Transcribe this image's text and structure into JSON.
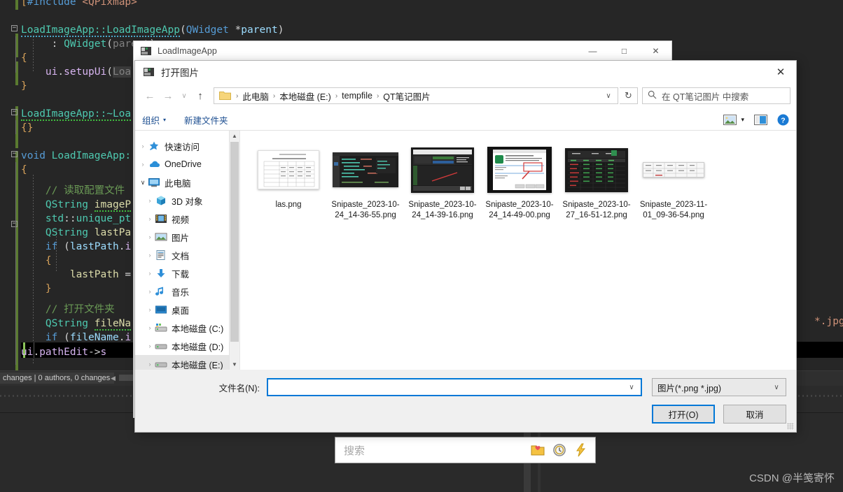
{
  "ide": {
    "code_lines": [
      "#include <QPixmap>",
      "",
      "LoadImageApp::LoadImageApp(QWidget *parent)",
      "    : QWidget(parent)",
      "{",
      "    ui.setupUi(Loa",
      "}",
      "",
      "LoadImageApp::~Loa",
      "{}",
      "",
      "void LoadImageApp:",
      "{",
      "    // 读取配置文件",
      "    QString imageP",
      "    std::unique_pt",
      "    QString lastPa",
      "    if (lastPath.i",
      "    {",
      "        lastPath =",
      "    }",
      "",
      "    // 打开文件夹",
      "    QString fileNa",
      "    if (fileName.i",
      "    ui.pathEdit->s"
    ],
    "right_fragment": "*.jpg);",
    "status_text": "changes | 0 authors, 0 changes"
  },
  "qt_search": {
    "placeholder": "搜索",
    "icons": [
      "folder-heart-icon",
      "clock-icon",
      "lightning-icon"
    ]
  },
  "watermark": "CSDN @半笺寄怀",
  "app_window": {
    "title": "LoadImageApp",
    "icon": "app-icon",
    "minimize": "—",
    "maximize": "□",
    "close": "✕"
  },
  "dialog": {
    "title": "打开图片",
    "icon": "app-icon",
    "close": "✕",
    "nav": {
      "back": "←",
      "forward": "→",
      "recent": "∨",
      "up": "↑",
      "refresh": "↻",
      "crumb_dropdown": "∨"
    },
    "breadcrumb": {
      "folder_icon": "folder-icon",
      "separator": "›",
      "items": [
        "此电脑",
        "本地磁盘 (E:)",
        "tempfile",
        "QT笔记图片"
      ]
    },
    "search": {
      "icon": "search-icon",
      "placeholder": "在 QT笔记图片 中搜索"
    },
    "toolbar": {
      "organize": "组织",
      "organize_caret": "▾",
      "new_folder": "新建文件夹",
      "view_icon": "view-mode-icon",
      "view_caret": "▾",
      "pane_icon": "preview-pane-icon",
      "help_icon": "help-icon",
      "help_glyph": "?"
    },
    "tree": [
      {
        "label": "快速访问",
        "icon": "pin-star-icon",
        "expander": "›",
        "indent": 0,
        "selected": false,
        "expanded": false
      },
      {
        "label": "OneDrive",
        "icon": "cloud-icon",
        "expander": "›",
        "indent": 0,
        "selected": false,
        "expanded": false
      },
      {
        "label": "此电脑",
        "icon": "computer-icon",
        "expander": "∨",
        "indent": 0,
        "selected": false,
        "expanded": true
      },
      {
        "label": "3D 对象",
        "icon": "cube-icon",
        "expander": "›",
        "indent": 1,
        "selected": false,
        "expanded": false
      },
      {
        "label": "视频",
        "icon": "video-icon",
        "expander": "›",
        "indent": 1,
        "selected": false,
        "expanded": false
      },
      {
        "label": "图片",
        "icon": "pictures-icon",
        "expander": "›",
        "indent": 1,
        "selected": false,
        "expanded": false
      },
      {
        "label": "文档",
        "icon": "documents-icon",
        "expander": "›",
        "indent": 1,
        "selected": false,
        "expanded": false
      },
      {
        "label": "下载",
        "icon": "downloads-icon",
        "expander": "›",
        "indent": 1,
        "selected": false,
        "expanded": false
      },
      {
        "label": "音乐",
        "icon": "music-icon",
        "expander": "›",
        "indent": 1,
        "selected": false,
        "expanded": false
      },
      {
        "label": "桌面",
        "icon": "desktop-icon",
        "expander": "›",
        "indent": 1,
        "selected": false,
        "expanded": false
      },
      {
        "label": "本地磁盘 (C:)",
        "icon": "system-drive-icon",
        "expander": "›",
        "indent": 1,
        "selected": false,
        "expanded": false
      },
      {
        "label": "本地磁盘 (D:)",
        "icon": "drive-icon",
        "expander": "›",
        "indent": 1,
        "selected": false,
        "expanded": false
      },
      {
        "label": "本地磁盘 (E:)",
        "icon": "drive-icon",
        "expander": "›",
        "indent": 1,
        "selected": true,
        "expanded": false
      }
    ],
    "tree_scroll": {
      "up": "▲",
      "down": "▼"
    },
    "files": [
      {
        "name": "las.png",
        "thumb": "document-scan"
      },
      {
        "name": "Snipaste_2023-10-24_14-36-55.png",
        "thumb": "dark-code"
      },
      {
        "name": "Snipaste_2023-10-24_14-39-16.png",
        "thumb": "dark-ide"
      },
      {
        "name": "Snipaste_2023-10-24_14-49-00.png",
        "thumb": "installer-dialog"
      },
      {
        "name": "Snipaste_2023-10-27_16-51-12.png",
        "thumb": "dark-table"
      },
      {
        "name": "Snipaste_2023-11-01_09-36-54.png",
        "thumb": "light-table"
      }
    ],
    "bottom": {
      "filename_label": "文件名(N):",
      "filename_value": "",
      "filename_caret": "∨",
      "filter_value": "图片(*.png *.jpg)",
      "filter_caret": "∨",
      "open_button": "打开(O)",
      "cancel_button": "取消"
    }
  },
  "colors": {
    "accent": "#0078d7",
    "link": "#1d4f91",
    "editor_bg": "#262626",
    "selection": "#e5e5e5"
  }
}
